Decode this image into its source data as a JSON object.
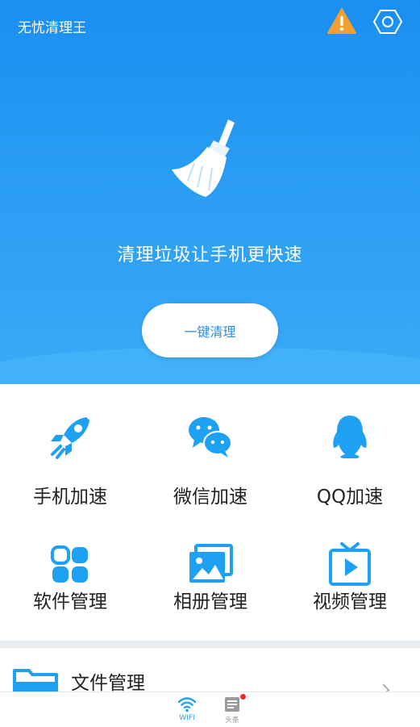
{
  "header": {
    "app_title": "无忧清理王"
  },
  "hero": {
    "tagline": "清理垃圾让手机更快速",
    "clean_button_label": "一键清理"
  },
  "features": [
    {
      "label": "手机加速",
      "icon": "rocket-icon"
    },
    {
      "label": "微信加速",
      "icon": "wechat-icon"
    },
    {
      "label": "QQ加速",
      "icon": "qq-penguin-icon"
    },
    {
      "label": "软件管理",
      "icon": "app-grid-icon"
    },
    {
      "label": "相册管理",
      "icon": "photo-album-icon"
    },
    {
      "label": "视频管理",
      "icon": "tv-play-icon"
    }
  ],
  "file_manager": {
    "label": "文件管理"
  },
  "bottom_nav": {
    "wifi_label": "WIFI",
    "news_label": "头条"
  },
  "colors": {
    "primary": "#1b8ff1",
    "accent_icon": "#1ea1f3",
    "badge": "#f02b2b",
    "warning": "#f0a030"
  }
}
